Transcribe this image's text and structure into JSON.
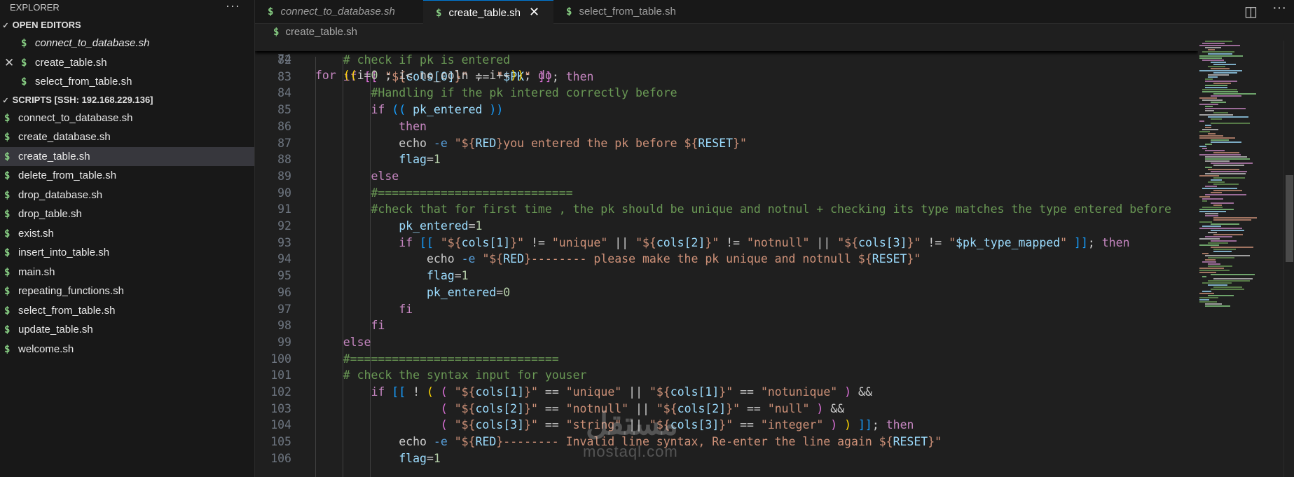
{
  "explorer": {
    "title": "EXPLORER",
    "more_icon": "···",
    "open_editors": {
      "title": "OPEN EDITORS",
      "items": [
        {
          "label": "connect_to_database.sh"
        },
        {
          "label": "create_table.sh"
        },
        {
          "label": "select_from_table.sh"
        }
      ]
    },
    "workspace": {
      "title": "SCRIPTS [SSH: 192.168.229.136]",
      "files": [
        {
          "label": "connect_to_database.sh"
        },
        {
          "label": "create_database.sh"
        },
        {
          "label": "create_table.sh"
        },
        {
          "label": "delete_from_table.sh"
        },
        {
          "label": "drop_database.sh"
        },
        {
          "label": "drop_table.sh"
        },
        {
          "label": "exist.sh"
        },
        {
          "label": "insert_into_table.sh"
        },
        {
          "label": "main.sh"
        },
        {
          "label": "repeating_functions.sh"
        },
        {
          "label": "select_from_table.sh"
        },
        {
          "label": "update_table.sh"
        },
        {
          "label": "welcome.sh"
        }
      ]
    }
  },
  "tabs": [
    {
      "label": "connect_to_database.sh"
    },
    {
      "label": "create_table.sh"
    },
    {
      "label": "select_from_table.sh"
    }
  ],
  "tab_close_icon": "✕",
  "file_icon_glyph": "$",
  "breadcrumb": {
    "file": "create_table.sh"
  },
  "editor": {
    "sticky_line": {
      "number": "74"
    },
    "line_numbers": [
      "82",
      "83",
      "84",
      "85",
      "86",
      "87",
      "88",
      "89",
      "90",
      "91",
      "92",
      "93",
      "94",
      "95",
      "96",
      "97",
      "98",
      "99",
      "100",
      "101",
      "102",
      "103",
      "104",
      "105",
      "106"
    ]
  },
  "watermark": {
    "text": "مستقل",
    "sub": "mostaql.com"
  },
  "colors": {
    "shell_icon": "#89d185",
    "keyword": "#c586c0",
    "comment": "#6a9955",
    "string": "#ce9178",
    "variable": "#9cdcfe",
    "active_tab_border": "#0078d4"
  }
}
